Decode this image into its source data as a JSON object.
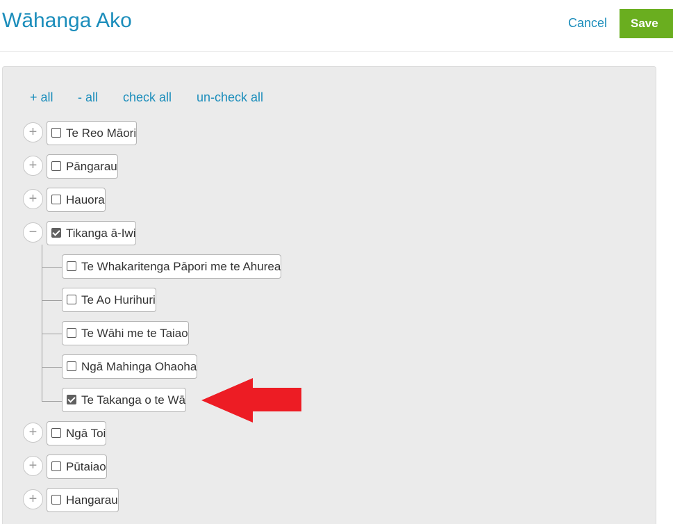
{
  "header": {
    "title": "Wāhanga Ako",
    "cancel_label": "Cancel",
    "save_label": "Save"
  },
  "actions": {
    "expand_all": "+ all",
    "collapse_all": "- all",
    "check_all": "check all",
    "uncheck_all": "un-check all"
  },
  "tree": {
    "items": [
      {
        "label": "Te Reo Māori",
        "checked": false,
        "expanded": false
      },
      {
        "label": "Pāngarau",
        "checked": false,
        "expanded": false
      },
      {
        "label": "Hauora",
        "checked": false,
        "expanded": false
      },
      {
        "label": "Tikanga ā-Iwi",
        "checked": true,
        "expanded": true,
        "children": [
          {
            "label": "Te Whakaritenga Pāpori me te Ahurea",
            "checked": false
          },
          {
            "label": "Te Ao Hurihuri",
            "checked": false
          },
          {
            "label": "Te Wāhi me te Taiao",
            "checked": false
          },
          {
            "label": "Ngā Mahinga Ohaoha",
            "checked": false
          },
          {
            "label": "Te Takanga o te Wā",
            "checked": true
          }
        ]
      },
      {
        "label": "Ngā Toi",
        "checked": false,
        "expanded": false
      },
      {
        "label": "Pūtaiao",
        "checked": false,
        "expanded": false
      },
      {
        "label": "Hangarau",
        "checked": false,
        "expanded": false
      }
    ],
    "expand_symbol": "+",
    "collapse_symbol": "−"
  },
  "colors": {
    "accent": "#1b8dbb",
    "save": "#6aae1f",
    "annotation_arrow": "#ed1c24"
  }
}
